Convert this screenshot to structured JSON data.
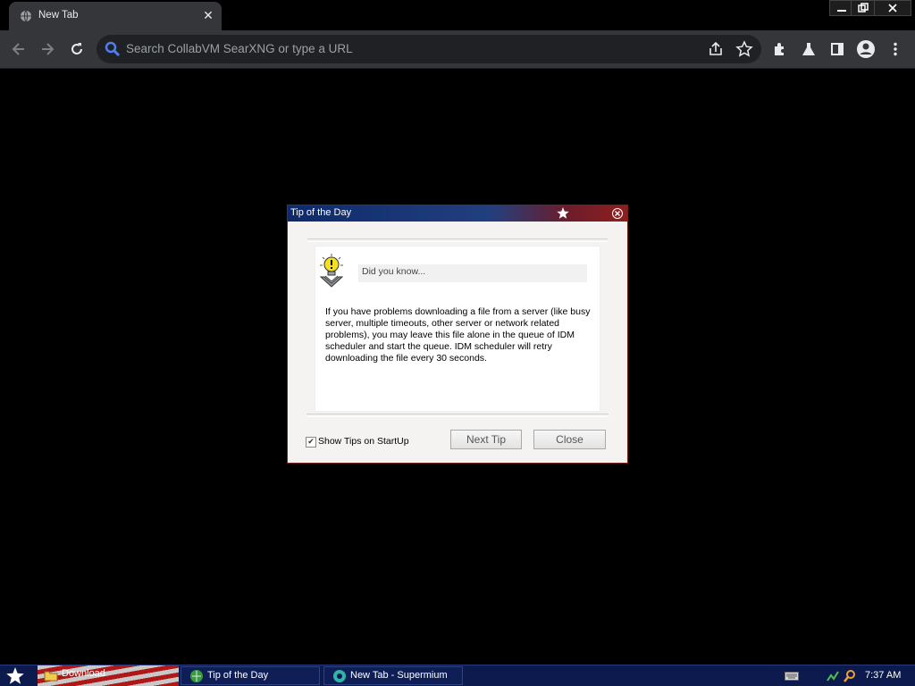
{
  "browser": {
    "tab": {
      "title": "New Tab",
      "close_glyph": "✕"
    },
    "window_controls": {
      "minimize": "—",
      "restore": "❐",
      "close": "✕"
    },
    "omnibox": {
      "placeholder": "Search CollabVM SearXNG or type a URL"
    },
    "icons": [
      "back-icon",
      "forward-icon",
      "reload-icon",
      "search-icon",
      "share-icon",
      "bookmark-star-icon",
      "extensions-icon",
      "labs-icon",
      "side-panel-icon",
      "profile-icon",
      "menu-icon"
    ]
  },
  "dialog": {
    "title": "Tip of the Day",
    "heading": "Did you know...",
    "tip_text": "If you have problems downloading a file from a server (like busy server, multiple timeouts, other server or network related problems), you may leave this file alone in the queue of IDM scheduler and start the queue. IDM scheduler will retry downloading the file every 30 seconds.",
    "checkbox": {
      "label": "Show Tips on StartUp",
      "checked": true,
      "mark": "✔"
    },
    "buttons": {
      "next": "Next Tip",
      "close": "Close"
    }
  },
  "taskbar": {
    "pinned": "Download",
    "tasks": [
      {
        "label": "Tip of the Day"
      },
      {
        "label": "New Tab - Supermium"
      }
    ],
    "clock": "7:37 AM"
  },
  "colors": {
    "accent": "#4f7ef0",
    "dialog_border": "#8e1e1e",
    "taskbar": "#0d1a4d"
  }
}
